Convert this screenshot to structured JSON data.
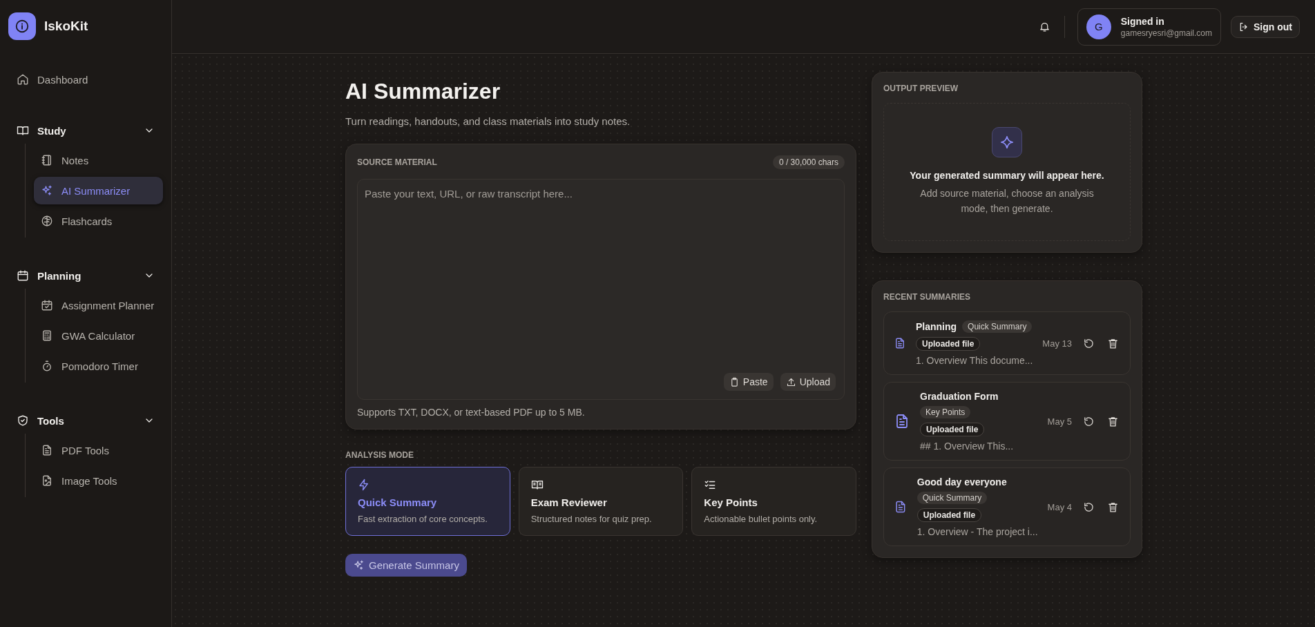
{
  "brand": {
    "name": "IskoKit"
  },
  "sidebar": {
    "items": [
      {
        "kind": "link",
        "label": "Dashboard",
        "selected": false
      },
      {
        "kind": "group",
        "label": "Study",
        "expanded": true,
        "children": [
          {
            "label": "Notes",
            "selected": false
          },
          {
            "label": "AI Summarizer",
            "selected": true
          },
          {
            "label": "Flashcards",
            "selected": false
          }
        ]
      },
      {
        "kind": "group",
        "label": "Planning",
        "expanded": true,
        "children": [
          {
            "label": "Assignment Planner",
            "selected": false
          },
          {
            "label": "GWA Calculator",
            "selected": false
          },
          {
            "label": "Pomodoro Timer",
            "selected": false
          }
        ]
      },
      {
        "kind": "group",
        "label": "Tools",
        "expanded": true,
        "children": [
          {
            "label": "PDF Tools",
            "selected": false
          },
          {
            "label": "Image Tools",
            "selected": false
          }
        ]
      }
    ]
  },
  "header": {
    "user": {
      "initial": "G",
      "status": "Signed in",
      "email": "gamesryesri@gmail.com"
    },
    "sign_out": "Sign out"
  },
  "page": {
    "title": "AI Summarizer",
    "subtitle": "Turn readings, handouts, and class materials into study notes."
  },
  "source": {
    "label": "SOURCE MATERIAL",
    "count": "0 / 30,000 chars",
    "placeholder": "Paste your text, URL, or raw transcript here...",
    "buttons": [
      "Paste",
      "Upload"
    ],
    "hint": "Supports TXT, DOCX, or text-based PDF up to 5 MB."
  },
  "analysis": {
    "label": "ANALYSIS MODE",
    "modes": [
      {
        "title": "Quick Summary",
        "description": "Fast extraction of core concepts.",
        "selected": true
      },
      {
        "title": "Exam Reviewer",
        "description": "Structured notes for quiz prep.",
        "selected": false
      },
      {
        "title": "Key Points",
        "description": "Actionable bullet points only.",
        "selected": false
      }
    ]
  },
  "generate_button": "Generate Summary",
  "output_preview": {
    "label": "OUTPUT PREVIEW",
    "heading": "Your generated summary will appear here.",
    "text": "Add source material, choose an analysis mode, then generate."
  },
  "recent": {
    "label": "RECENT SUMMARIES",
    "items": [
      {
        "title": "Planning",
        "mode": "Quick Summary",
        "source": "Uploaded file",
        "date": "May 13",
        "preview": "1. Overview This docume..."
      },
      {
        "title": "Graduation Form",
        "mode": "Key Points",
        "source": "Uploaded file",
        "date": "May 5",
        "preview": "## 1. Overview This..."
      },
      {
        "title": "Good day everyone",
        "mode": "Quick Summary",
        "source": "Uploaded file",
        "date": "May 4",
        "preview": "1. Overview - The project i..."
      }
    ]
  }
}
